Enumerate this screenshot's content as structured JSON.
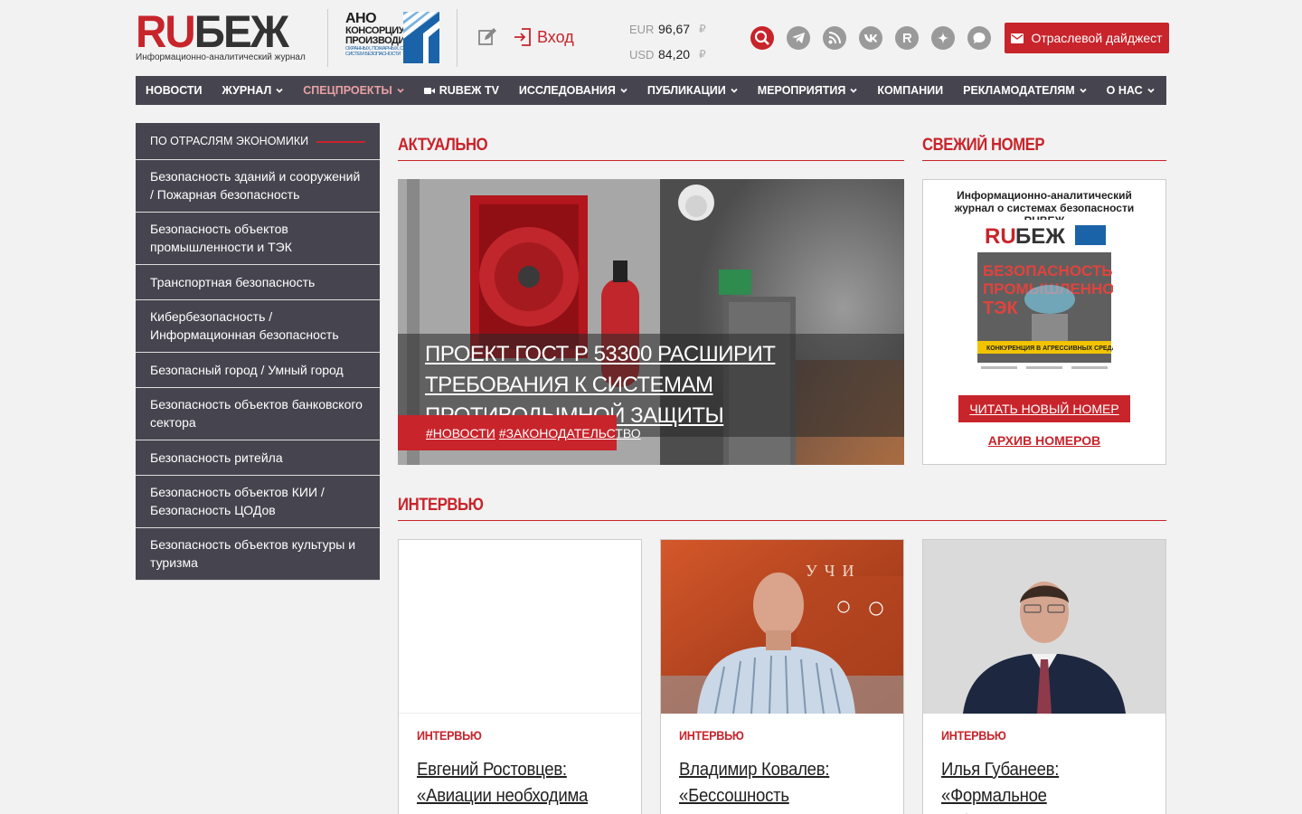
{
  "header": {
    "logo_ru": "RU",
    "logo_bezh": "БЕЖ",
    "logo_subtitle": "Информационно-аналитический журнал",
    "ano_line1": "АНО",
    "ano_line2": "КОНСОРЦИУМ",
    "ano_line3": "ПРОИЗВОДИТЕЛИ",
    "ano_line4": "ОХРАННЫХ, ПОЖАРНЫХ, СКУД",
    "ano_line5": "СИСТЕМ БЕЗОПАСНОСТИ",
    "login_label": "Вход",
    "rates": [
      {
        "currency": "EUR",
        "value": "96,67",
        "symbol": "₽"
      },
      {
        "currency": "USD",
        "value": "84,20",
        "symbol": "₽"
      }
    ],
    "digest_label": "Отраслевой дайджест"
  },
  "nav": {
    "items": [
      {
        "label": "НОВОСТИ",
        "dropdown": false
      },
      {
        "label": "ЖУРНАЛ",
        "dropdown": true
      },
      {
        "label": "СПЕЦПРОЕКТЫ",
        "dropdown": true
      },
      {
        "label": "RUBEЖ TV",
        "dropdown": false
      },
      {
        "label": "ИССЛЕДОВАНИЯ",
        "dropdown": true
      },
      {
        "label": "ПУБЛИКАЦИИ",
        "dropdown": true
      },
      {
        "label": "МЕРОПРИЯТИЯ",
        "dropdown": true
      },
      {
        "label": "КОМПАНИИ",
        "dropdown": false
      },
      {
        "label": "РЕКЛАМОДАТЕЛЯМ",
        "dropdown": true
      },
      {
        "label": "О НАС",
        "dropdown": true
      }
    ]
  },
  "sidebar": {
    "heading": "ПО ОТРАСЛЯМ ЭКОНОМИКИ",
    "items": [
      "Безопасность зданий и сооружений / Пожарная безопасность",
      "Безопасность объектов промышленности и ТЭК",
      "Транспортная безопасность",
      "Кибербезопасность / Информационная безопасность",
      "Безопасный город / Умный город",
      "Безопасность объектов банковского сектора",
      "Безопасность ритейла",
      "Безопасность объектов КИИ / Безопасность ЦОДов",
      "Безопасность объектов культуры и туризма"
    ]
  },
  "actual": {
    "title": "АКТУАЛЬНО",
    "headline": "ПРОЕКТ ГОСТ Р 53300 РАСШИРИТ ТРЕБОВАНИЯ К СИСТЕМАМ ПРОТИВОДЫМНОЙ ЗАЩИТЫ",
    "tag1": "#НОВОСТИ",
    "tag2": "#ЗАКОНОДАТЕЛЬСТВО"
  },
  "fresh_issue": {
    "title": "СВЕЖИЙ НОМЕР",
    "description": "Информационно-аналитический журнал о системах безопасности RUBEЖ",
    "cover_title": "БЕЗОПАСНОСТЬ ПРОМЫШЛЕННОСТИ ТЭК",
    "cover_banner": "КОНКУРЕНЦИЯ В АГРЕССИВНЫХ СРЕДАХ",
    "read_label": "ЧИТАТЬ НОВЫЙ НОМЕР",
    "archive_label": "АРХИВ НОМЕРОВ"
  },
  "interview": {
    "title": "ИНТЕРВЬЮ",
    "cards": [
      {
        "category": "ИНТЕРВЬЮ",
        "title": "Евгений Ростовцев:\n«Авиации необходима"
      },
      {
        "category": "ИНТЕРВЬЮ",
        "title": "Владимир Ковалев:\n«Бессошность измеряется"
      },
      {
        "category": "ИНТЕРВЬЮ",
        "title": "Илья Губанеев:\n«Формальное соблюдение"
      }
    ]
  },
  "colors": {
    "accent": "#c8242b",
    "nav_bg": "#46454f",
    "page_bg": "#f2f2f2"
  },
  "icons": [
    "edit-icon",
    "login-icon",
    "search-icon",
    "telegram-icon",
    "rss-icon",
    "vk-icon",
    "rutube-icon",
    "dzen-icon",
    "chat-icon",
    "mail-icon",
    "video-camera-icon",
    "chevron-down-icon"
  ]
}
